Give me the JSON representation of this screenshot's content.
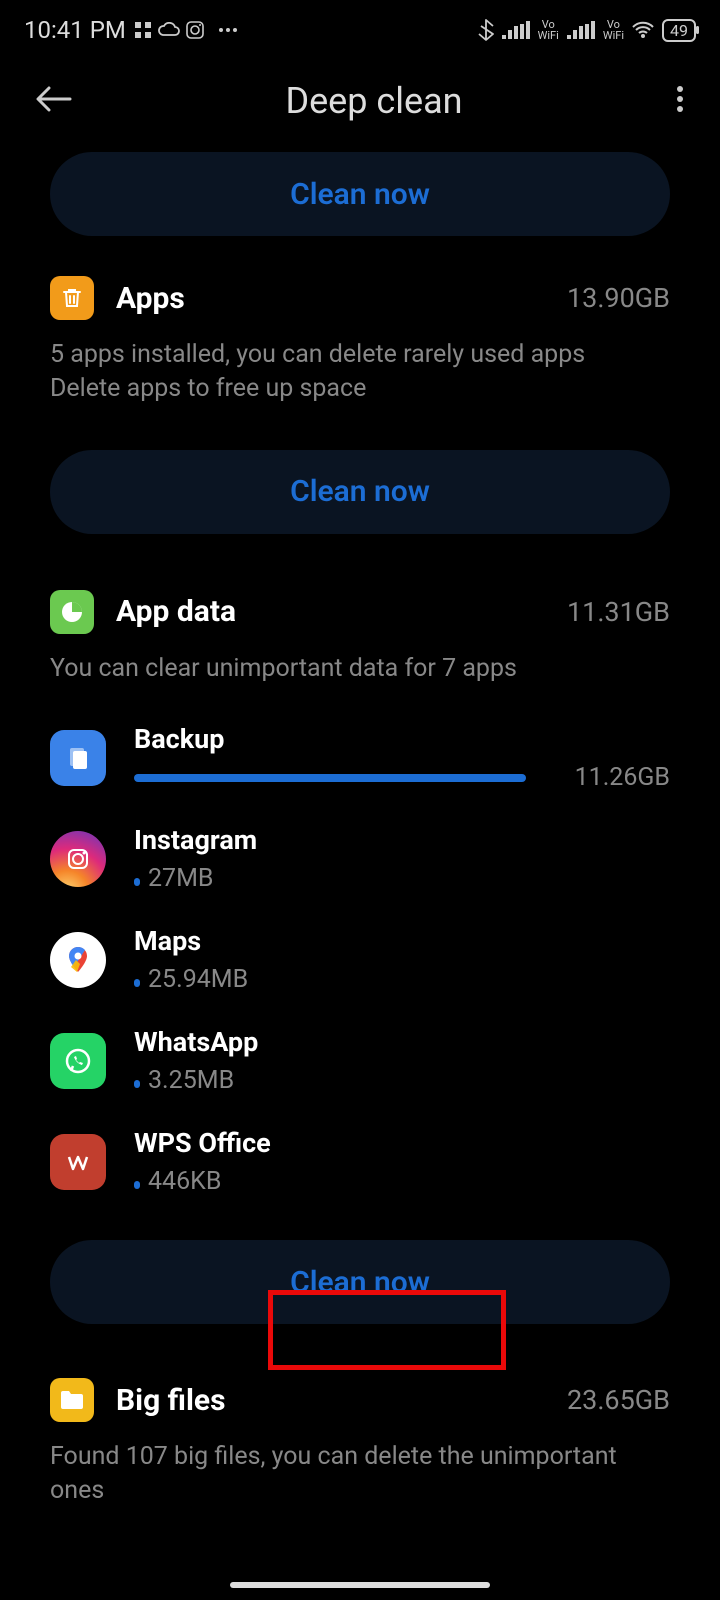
{
  "status": {
    "time": "10:41 PM",
    "battery": "49"
  },
  "header": {
    "title": "Deep clean"
  },
  "clean_label": "Clean now",
  "sections": {
    "apps": {
      "title": "Apps",
      "size": "13.90GB",
      "desc": "5 apps installed, you can delete rarely used apps\nDelete apps to free up space"
    },
    "appdata": {
      "title": "App data",
      "size": "11.31GB",
      "desc": "You can clear unimportant data for 7 apps",
      "items": [
        {
          "name": "Backup",
          "size": "11.26GB",
          "percent": 92
        },
        {
          "name": "Instagram",
          "size": "27MB",
          "percent": 0.3
        },
        {
          "name": "Maps",
          "size": "25.94MB",
          "percent": 0.3
        },
        {
          "name": "WhatsApp",
          "size": "3.25MB",
          "percent": 0.1
        },
        {
          "name": "WPS Office",
          "size": "446KB",
          "percent": 0.05
        }
      ]
    },
    "bigfiles": {
      "title": "Big files",
      "size": "23.65GB",
      "desc": "Found 107 big files, you can delete the unimportant ones"
    }
  }
}
